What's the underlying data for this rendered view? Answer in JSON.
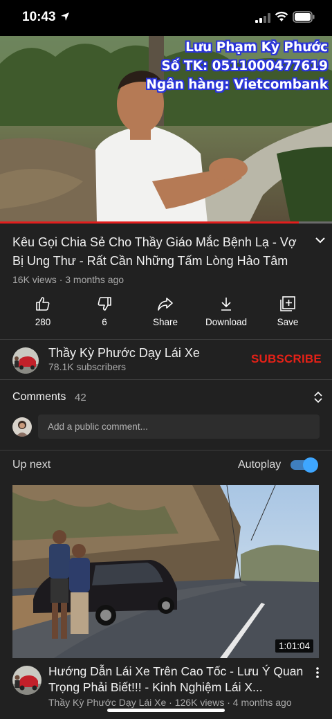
{
  "status_bar": {
    "time": "10:43"
  },
  "video": {
    "overlay_lines": [
      "Lưu Phạm Kỳ Phước",
      "Số TK: 0511000477619",
      "Ngân hàng: Vietcombank"
    ],
    "progress_fraction": 0.9,
    "title": "Kêu Gọi Chia Sẻ Cho Thầy Giáo Mắc Bệnh Lạ - Vợ Bị Ung Thư - Rất Cần Những Tấm Lòng Hảo Tâm",
    "meta": "16K views · 3 months ago"
  },
  "actions": {
    "like": "280",
    "dislike": "6",
    "share": "Share",
    "download": "Download",
    "save": "Save"
  },
  "channel": {
    "name": "Thầy Kỳ Phước Dạy Lái Xe",
    "subscribers": "78.1K subscribers",
    "subscribe_label": "SUBSCRIBE"
  },
  "comments": {
    "label": "Comments",
    "count": "42",
    "placeholder": "Add a public comment..."
  },
  "up_next": {
    "label": "Up next",
    "autoplay_label": "Autoplay",
    "autoplay_on": true,
    "duration": "1:01:04",
    "title": "Hướng Dẫn Lái Xe Trên Cao Tốc - Lưu Ý Quan Trọng Phải Biết!!! - Kinh Nghiệm Lái X...",
    "meta": "Thầy Kỳ Phước Dạy Lái Xe · 126K views · 4 months ago"
  },
  "icons": [
    "location-arrow-icon",
    "signal-icon",
    "wifi-icon",
    "battery-icon",
    "chevron-down-icon",
    "thumbs-up-icon",
    "thumbs-down-icon",
    "share-icon",
    "download-icon",
    "save-icon",
    "sort-icon",
    "more-vert-icon"
  ],
  "colors": {
    "background": "#212121",
    "subscribe": "#e62117",
    "progress": "#e21d1d",
    "toggle": "#3ea6ff"
  }
}
